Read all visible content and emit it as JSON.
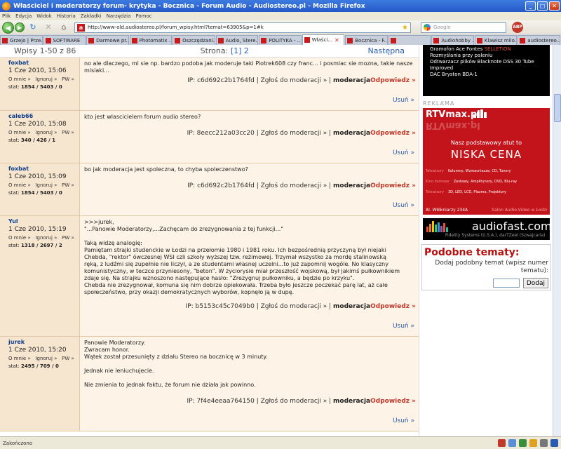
{
  "window": {
    "title": "Właściciel i moderatorzy forum- krytyka - Bocznica - Forum Audio - Audiostereo.pl - Mozilla Firefox",
    "min": "_",
    "max": "□",
    "close": "✕"
  },
  "menu": [
    "Plik",
    "Edycja",
    "Widok",
    "Historia",
    "Zakładki",
    "Narzędzia",
    "Pomoc"
  ],
  "nav": {
    "back": "◀",
    "forward": "▶",
    "reload": "↻",
    "stop": "✕",
    "home": "⌂",
    "url": "http://www-old.audiostereo.pl/forum_wpisy.html?temat=63905&p=1#k",
    "search_placeholder": "Google",
    "abp": "ABP"
  },
  "tabs": [
    {
      "label": "Grzejo | Prze..."
    },
    {
      "label": "SOFTWARE"
    },
    {
      "label": "Darmowe pr..."
    },
    {
      "label": "Photomatix ..."
    },
    {
      "label": "Oszczędzani..."
    },
    {
      "label": "Audio, Stere..."
    },
    {
      "label": "POLITYKA - ..."
    },
    {
      "label": "Właści...",
      "active": true
    },
    {
      "label": "Bocznica - F..."
    },
    {
      "label": ""
    },
    {
      "label": "Audiohobby ..."
    },
    {
      "label": "Klawisz milo..."
    },
    {
      "label": "audiostereo..."
    }
  ],
  "pager": {
    "count": "Wpisy 1-50 z 86",
    "strona_label": "Strona:",
    "current": "[1]",
    "other": "2",
    "next": "Następna"
  },
  "labels": {
    "o_mnie": "O mnie »",
    "ignoruj": "Ignoruj »",
    "pw": "PW »",
    "stat": "stat:",
    "ip": "IP:",
    "zglos": "| Zgłoś do moderacji » |",
    "moderacja": "moderacja",
    "odpowiedz": "Odpowiedz »",
    "usun": "Usuń »"
  },
  "posts": [
    {
      "author": "foxbat",
      "date": "1 Cze 2010, 15:06",
      "stat": "1854 / 5403 / 0",
      "text": "no ale dlaczego, mi sie np. bardzo podoba jak moderuje taki Piotrek608 czy franc... i posmiac sie mozna, takie nasze misiaki...",
      "ip": "c6d692c2b1764fd"
    },
    {
      "author": "caleb66",
      "date": "1 Cze 2010, 15:08",
      "stat": "340 / 426 / 1",
      "text": "kto jest wlascicielem forum audio stereo?",
      "ip": "8eecc212a03cc20"
    },
    {
      "author": "foxbat",
      "date": "1 Cze 2010, 15:09",
      "stat": "1854 / 5403 / 0",
      "text": "bo jak moderacja jest spoleczna, to chyba spoleczenstwo?",
      "ip": "c6d692c2b1764fd"
    },
    {
      "author": "Yul",
      "date": "1 Cze 2010, 15:19",
      "stat": "1318 / 2697 / 2",
      "text": ">>>jurek,\n\"...Panowie Moderatorzy,...Zachęcam do zrezygnowania z tej funkcji...\"\n\nTaką widzę analogię:\nPamiętam strajki studenckie w Łodzi na przełomie 1980 i 1981 roku. Ich bezpośrednią przyczyną był niejaki\nChebda, \"rektor\" ówczesnej WSI czli szkoły wyższej tzw. reżimowej. Trzymał wszystko za mordę stalinowską\nręką, z ludźmi się zupełnie nie liczył, a ze studentami własnej uczelni...to już zapomnij wogóle. No klasyczny\nkomunistyczny, w teczce przyniesony, \"beton\". W życiorysie miał przeszłość wojskową, był jakimś pułkownikiem\nzdaje się. Na strajku wznoszono następujące hasło: \"Zrezygnuj pułkowniku, a będzie po krzyku\".\nChebda nie zrezygnował, komuna się nim dobrze opiekowała. Trzeba było jeszcze poczekać parę lat, aż całe\nspołeczeństwo, przy okazji demokratycznych wyborów, kopnęło ją w dupę.",
      "ip": "b5153c45c7049b0"
    },
    {
      "author": "jurek",
      "date": "1 Cze 2010, 15:20",
      "stat": "2495 / 709 / 0",
      "text": "Panowie Moderatorzy.\nZwracam honor.\nWątek został przesunięty z działu Stereo na bocznicę w 3 minuty.\n\nJednak nie leniuchujecie.\n\nNie zmienia to jednak faktu, że forum nie działa jak powinno.",
      "ip": "7f4e4eeaa764150"
    }
  ],
  "sidebar": {
    "list": [
      {
        "text": "Gramofon Ace Fontes",
        "tag": "SELLETION"
      },
      {
        "text": "Rozmyślania przy paleniu",
        "tag": ""
      },
      {
        "text": "Odtwarzacz plików Blacknote DSS 30 Tube Improved",
        "tag": ""
      },
      {
        "text": "DAC Bryston BDA-1",
        "tag": ""
      }
    ],
    "reklama": "REKLAMA",
    "rtv": {
      "brand": "RTVmax.pl",
      "slogan": "Nasz podstawowy atut to",
      "big": "NISKA CENA",
      "rows": [
        {
          "cat": "Telewizory",
          "items": "Kolumny, Wzmacniacze, CD, Tunery"
        },
        {
          "cat": "Kino domowe",
          "items": "Zestawy, Amplitunery, DVD, Blu-ray"
        },
        {
          "cat": "Telewizory",
          "items": "3D, LED, LCD, Plazma, Projektory"
        }
      ],
      "addr": "Al. Włókniarzy 234A",
      "addr2": "Salon Audio-Video w Łodzi"
    },
    "audiofast": {
      "name": "audiofast.com",
      "sub": "Fidelity Systems (U.S.A.), darTZeel (Szwajcaria)"
    },
    "podobne": {
      "title": "Podobne tematy:",
      "desc": "Dodaj podobny temat (wpisz numer tematu):",
      "button": "Dodaj"
    }
  },
  "status": {
    "text": "Zakończono"
  },
  "colors": {
    "accent_red": "#c0392b",
    "post_bg": "#fdf3e6",
    "post_side": "#f7e6cf",
    "link_blue": "#2a5db0"
  }
}
